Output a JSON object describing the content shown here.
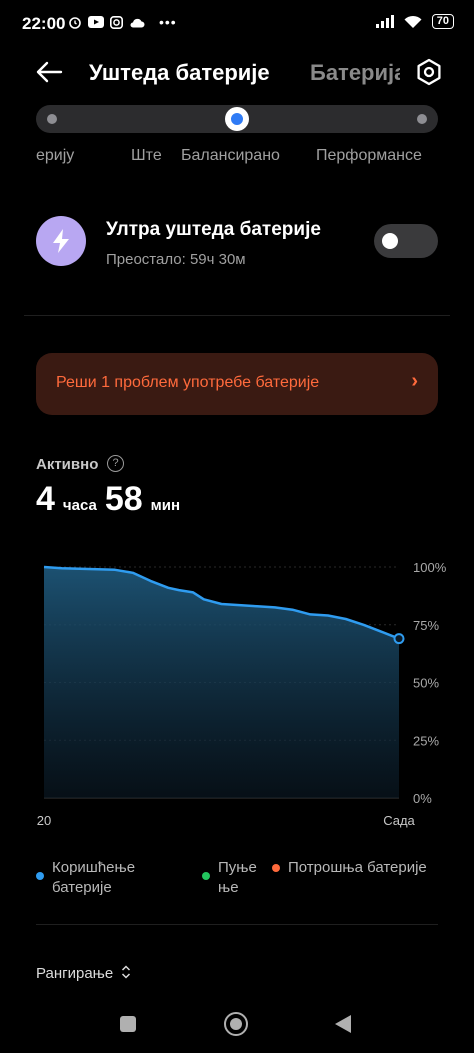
{
  "status_bar": {
    "time": "22:00",
    "battery": "70"
  },
  "header": {
    "title": "Уштеда батерије",
    "next_tab": "Батерија",
    "settings_icon": "hexagon-gear-icon"
  },
  "mode_slider": {
    "labels": [
      "ерију",
      "Ште",
      "Балансирано",
      "Перформансе"
    ],
    "selected": "Балансирано"
  },
  "ultra_saver": {
    "title": "Ултра уштеда батерије",
    "subtitle": "Преостало: 59ч 30м",
    "enabled": false
  },
  "problem_card": {
    "text": "Реши 1 проблем употребе батерије",
    "arrow": "›"
  },
  "active": {
    "label": "Активно",
    "help": "?",
    "hours": "4",
    "hours_unit": "часа",
    "minutes": "58",
    "minutes_unit": "мин"
  },
  "chart_data": {
    "type": "area",
    "x_tick_labels": [
      "20",
      "Сада"
    ],
    "y_tick_labels": [
      "100%",
      "75%",
      "50%",
      "25%",
      "0%"
    ],
    "ylim": [
      0,
      100
    ],
    "series": [
      {
        "name": "Коришћење батерије",
        "color": "#2f9cf0",
        "x": [
          0,
          5,
          10,
          15,
          20,
          25,
          30,
          35,
          38,
          42,
          45,
          50,
          55,
          60,
          65,
          70,
          75,
          80,
          85,
          90,
          95,
          100
        ],
        "values": [
          100,
          99.5,
          99.2,
          99,
          98.8,
          97.5,
          94,
          91,
          90,
          89,
          86,
          84,
          83.5,
          83,
          82.5,
          81.5,
          79.5,
          79,
          77.5,
          75,
          72,
          69
        ]
      }
    ],
    "legend": [
      {
        "name": "Коришћење\nбатерије",
        "color": "#2f9cf0"
      },
      {
        "name": "Пуње\nње",
        "color": "#22c55e"
      },
      {
        "name": "Потрошња батерије",
        "color": "#ff6a3c"
      }
    ]
  },
  "ranking": {
    "label": "Рангирање",
    "icon": "sort-updown-icon"
  },
  "nav": {
    "recents_icon": "square-icon",
    "home_icon": "circle-icon",
    "back_icon": "triangle-back-icon"
  }
}
